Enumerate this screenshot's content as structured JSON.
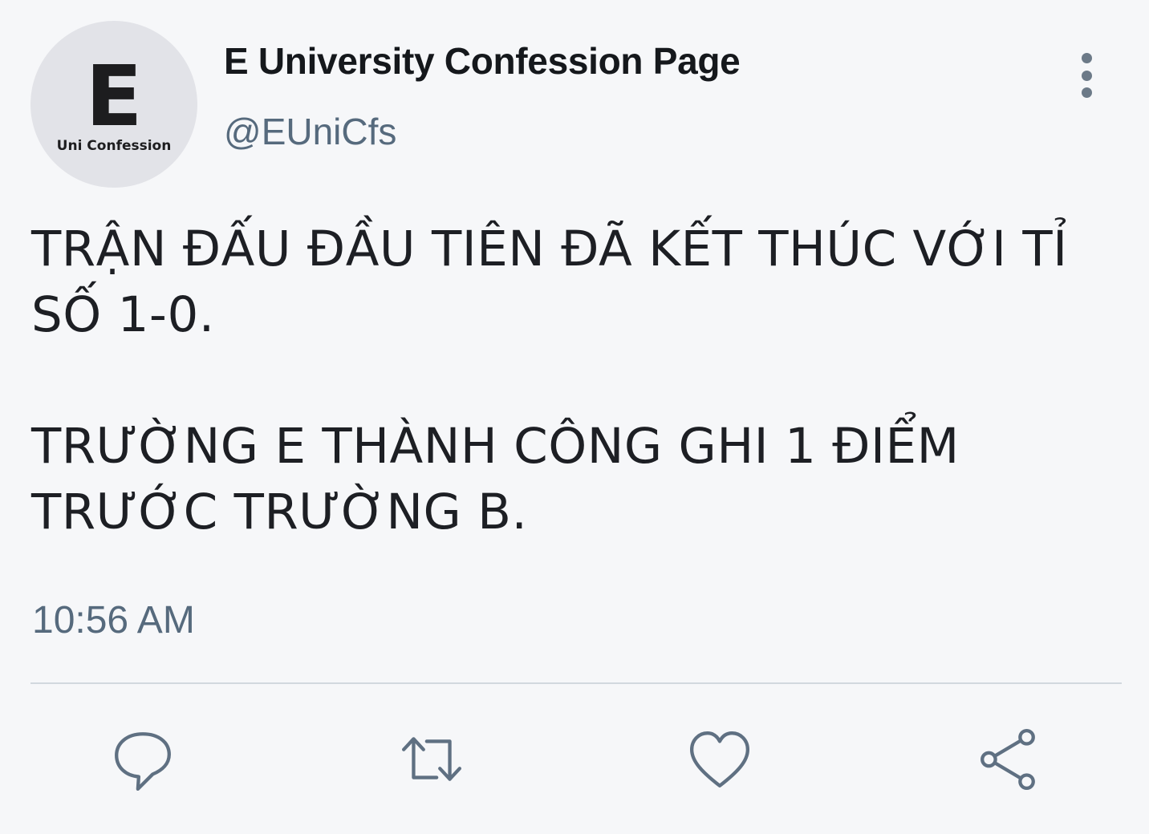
{
  "author": {
    "avatar_letter": "E",
    "avatar_caption": "Uni Confession",
    "display_name": "E University Confession Page",
    "handle": "@EUniCfs"
  },
  "tweet": {
    "paragraphs": [
      "TRẬN ĐẤU ĐẦU TIÊN ĐÃ KẾT THÚC VỚI TỈ SỐ 1-0.",
      "TRƯỜNG E THÀNH CÔNG GHI 1 ĐIỂM TRƯỚC TRƯỜNG B."
    ],
    "time": "10:56 AM"
  },
  "actions": [
    {
      "icon": "reply-icon"
    },
    {
      "icon": "retweet-icon"
    },
    {
      "icon": "heart-icon"
    },
    {
      "icon": "share-icon"
    }
  ],
  "colors": {
    "background": "#f6f7f9",
    "text": "#15181c",
    "secondary_text": "#566a7d",
    "icon": "#5f7082",
    "divider": "#d2d8de",
    "avatar_bg": "#e2e3e8"
  }
}
